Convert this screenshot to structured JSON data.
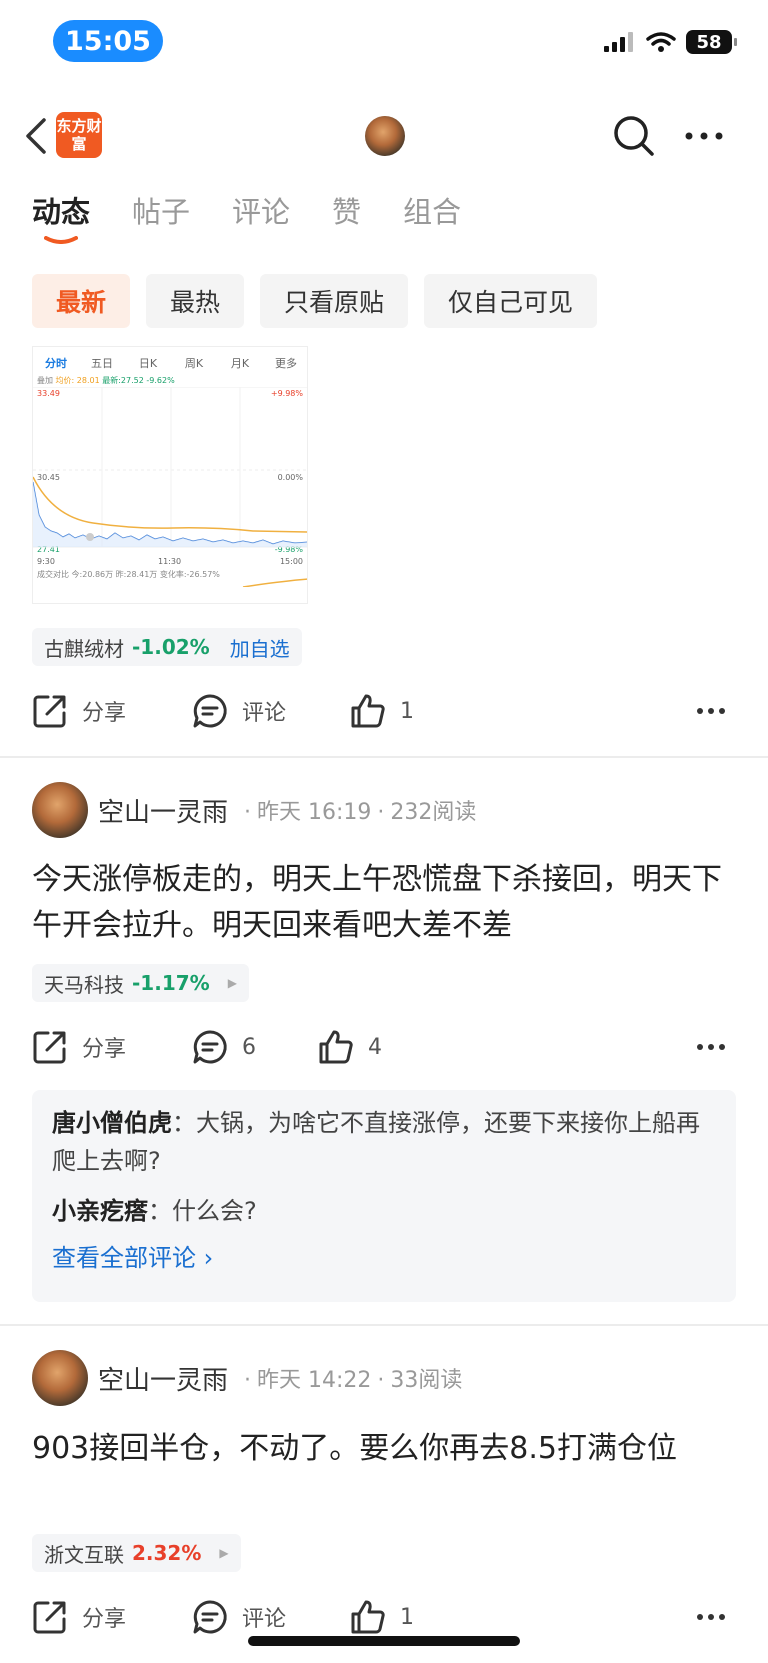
{
  "status_bar": {
    "time": "15:05",
    "battery": "58"
  },
  "nav": {
    "logo_text": "东方财富"
  },
  "tabs": [
    {
      "label": "动态",
      "active": true
    },
    {
      "label": "帖子"
    },
    {
      "label": "评论"
    },
    {
      "label": "赞"
    },
    {
      "label": "组合"
    }
  ],
  "filters": [
    {
      "label": "最新",
      "active": true
    },
    {
      "label": "最热"
    },
    {
      "label": "只看原贴"
    },
    {
      "label": "仅自己可见"
    }
  ],
  "chart_thumb": {
    "tabs": [
      "分时",
      "五日",
      "日K",
      "周K",
      "月K",
      "更多"
    ],
    "legend_prefix": "叠加",
    "legend_avg": "均价: 28.01",
    "legend_last": "最新:27.52 -9.62%",
    "price_high": "33.49",
    "pct_high": "+9.98%",
    "price_mid": "30.45",
    "pct_mid": "0.00%",
    "price_low": "27.41",
    "pct_low": "-9.98%",
    "time_start": "9:30",
    "time_mid": "11:30",
    "time_end": "15:00",
    "volume_text": "成交对比 今:20.86万 昨:28.41万 变化率:-26.57%"
  },
  "post1": {
    "stock_name": "古麒绒材",
    "stock_pct": "-1.02%",
    "add_watch": "加自选",
    "share_label": "分享",
    "comment_label": "评论",
    "like_count": "1"
  },
  "post2": {
    "author": "空山一灵雨",
    "time": "昨天 16:19",
    "reads": "232阅读",
    "text": "今天涨停板走的，明天上午恐慌盘下杀接回，明天下午开会拉升。明天回来看吧大差不差",
    "stock_name": "天马科技",
    "stock_pct": "-1.17%",
    "share_label": "分享",
    "comment_count": "6",
    "like_count": "4",
    "comments": [
      {
        "author": "唐小僧伯虎",
        "text": "：大锅，为啥它不直接涨停，还要下来接你上船再爬上去啊?"
      },
      {
        "author": "小亲疙瘩",
        "text": "：什么会?"
      }
    ],
    "view_all": "查看全部评论 ›"
  },
  "post3": {
    "author": "空山一灵雨",
    "time": "昨天 14:22",
    "reads": "33阅读",
    "text": "903接回半仓，不动了。要么你再去8.5打满仓位",
    "stock_name": "浙文互联",
    "stock_pct": "2.32%",
    "share_label": "分享",
    "comment_label": "评论",
    "like_count": "1"
  },
  "colors": {
    "accent": "#f05a22",
    "link": "#1a6fd0",
    "down": "#18a06a",
    "up": "#e8402a",
    "time_pill": "#1a8cff"
  }
}
